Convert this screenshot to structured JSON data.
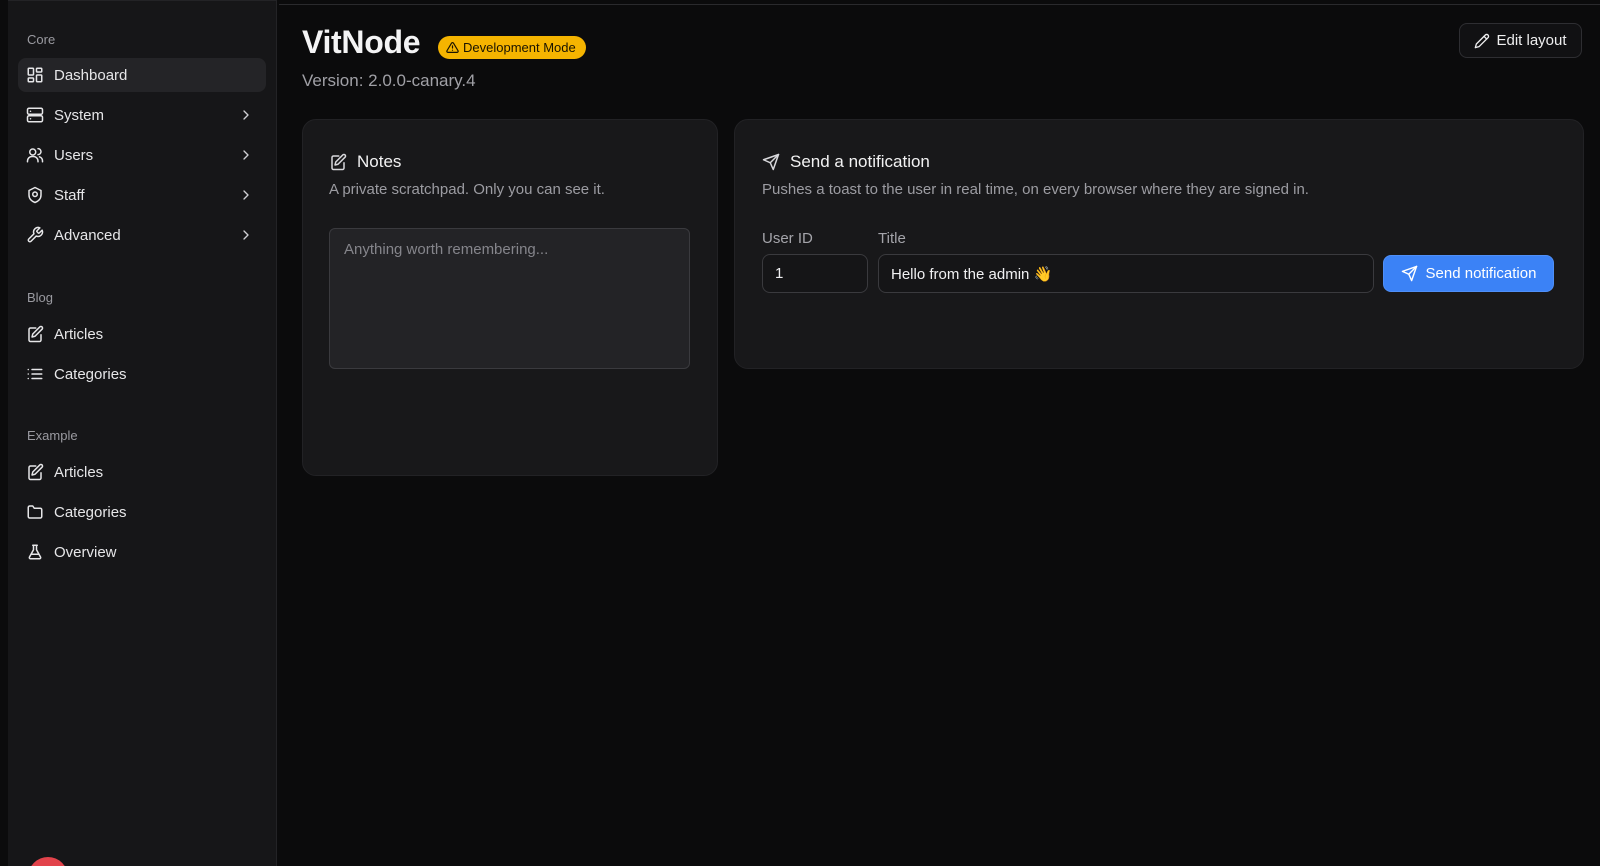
{
  "app": {
    "title": "VitNode",
    "badge": "Development Mode",
    "version": "Version: 2.0.0-canary.4"
  },
  "header": {
    "edit_layout_label": "Edit layout"
  },
  "sidebar": {
    "sections": [
      {
        "label": "Core",
        "items": [
          {
            "label": "Dashboard",
            "icon": "dashboard-icon",
            "active": true
          },
          {
            "label": "System",
            "icon": "server-icon"
          },
          {
            "label": "Users",
            "icon": "users-icon"
          },
          {
            "label": "Staff",
            "icon": "shield-icon"
          },
          {
            "label": "Advanced",
            "icon": "wrench-icon"
          }
        ]
      },
      {
        "label": "Blog",
        "items": [
          {
            "label": "Articles",
            "icon": "edit-document-icon"
          },
          {
            "label": "Categories",
            "icon": "list-icon"
          }
        ]
      },
      {
        "label": "Example",
        "items": [
          {
            "label": "Articles",
            "icon": "edit-document-icon"
          },
          {
            "label": "Categories",
            "icon": "folder-icon"
          },
          {
            "label": "Overview",
            "icon": "flask-icon"
          }
        ]
      }
    ]
  },
  "notes": {
    "title": "Notes",
    "description": "A private scratchpad. Only you can see it.",
    "placeholder": "Anything worth remembering..."
  },
  "notification": {
    "title": "Send a notification",
    "description": "Pushes a toast to the user in real time, on every browser where they are signed in.",
    "user_id_label": "User ID",
    "user_id_value": "1",
    "title_label": "Title",
    "title_value": "Hello from the admin 👋",
    "send_label": "Send notification"
  },
  "colors": {
    "accent": "#3b82f6",
    "badge": "#f5b400",
    "background": "#0b0b0c",
    "card": "#18181a"
  }
}
